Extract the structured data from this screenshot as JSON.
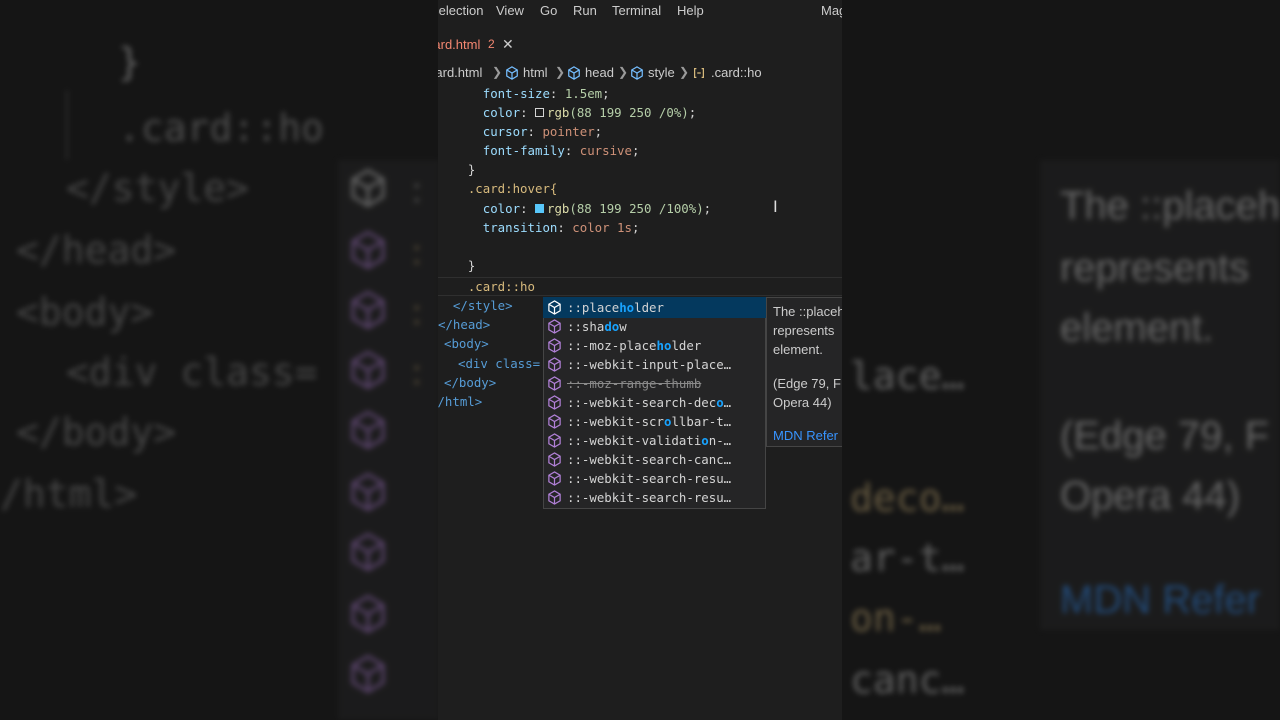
{
  "menubar": {
    "items": [
      "Selection",
      "View",
      "Go",
      "Run",
      "Terminal",
      "Help"
    ],
    "right_label": "Mag"
  },
  "tab": {
    "filename": "Card.html",
    "problems": "2",
    "close": "✕"
  },
  "breadcrumb": [
    "Card.html",
    "html",
    "head",
    "style",
    ".card::ho"
  ],
  "code": {
    "l1": {
      "prop": "font-size",
      "val": "1.5em"
    },
    "l2": {
      "prop": "color",
      "fn": "rgb",
      "args": "(88 199 250 /0%)"
    },
    "l3": {
      "prop": "cursor",
      "val": "pointer"
    },
    "l4": {
      "prop": "font-family",
      "val": "cursive"
    },
    "l5": "}",
    "l6": ".card:hover{",
    "l7": {
      "prop": "color",
      "fn": "rgb",
      "args": "(88 199 250 /100%)"
    },
    "l8": {
      "prop": "transition",
      "val": "color 1s"
    },
    "l9": "}",
    "l10": ".card::ho",
    "l11": "</style>",
    "l12": "</head>",
    "l13": "<body>",
    "l14": "<div class=",
    "l15": "</body>",
    "l16": "</html>"
  },
  "swatches": {
    "transparent": "#1e1e1e",
    "blue": "#58c7fa"
  },
  "suggestions": [
    {
      "pre": "::place",
      "hl": "ho",
      "post": "lder",
      "active": true
    },
    {
      "pre": "::sha",
      "hl": "do",
      "post": "w"
    },
    {
      "pre": "::-moz-place",
      "hl": "ho",
      "post": "lder"
    },
    {
      "pre": "::-webkit-input-place",
      "hl": "",
      "post": "…"
    },
    {
      "pre": "::-moz-range-thumb",
      "hl": "",
      "post": "",
      "deprecated": true
    },
    {
      "pre": "::-webkit-search-dec",
      "hl": "o",
      "post": "…"
    },
    {
      "pre": "::-webkit-scr",
      "hl": "o",
      "post": "llbar-t…"
    },
    {
      "pre": "::-webkit-validati",
      "hl": "o",
      "post": "n-…"
    },
    {
      "pre": "::-webkit-search-canc",
      "hl": "",
      "post": "…"
    },
    {
      "pre": "::-webkit-search-resu",
      "hl": "",
      "post": "…"
    },
    {
      "pre": "::-webkit-search-resu",
      "hl": "",
      "post": "…"
    }
  ],
  "details": {
    "lines": [
      "The ::placeh",
      "represents",
      "element."
    ],
    "compat1": "(Edge 79, F",
    "compat2": "Opera 44)",
    "mdn": "MDN Refer"
  },
  "background": {
    "brace": "}",
    "selector": ".card::ho",
    "style_close": "</style>",
    "head_close": "</head>",
    "body_open": "<body>",
    "div_open": "<div class=",
    "body_close": "</body>",
    "html_close": "/html>",
    "desc1": "The ::placeh",
    "desc2": "represents",
    "desc3": "element.",
    "item1": "lace…",
    "compat1": "(Edge 79, F",
    "compat2": "Opera 44)",
    "item2": "deco…",
    "item3": "ar-t…",
    "mdn": "MDN Refer",
    "item4": "on-…",
    "item5": "canc…"
  },
  "icons": {
    "symbol": "cube-icon",
    "tag": "cube-outline-icon",
    "selector": "brackets-icon"
  },
  "colors": {
    "accent_purple": "#b180d7",
    "error": "#f48771",
    "highlight": "#18a3ff"
  }
}
